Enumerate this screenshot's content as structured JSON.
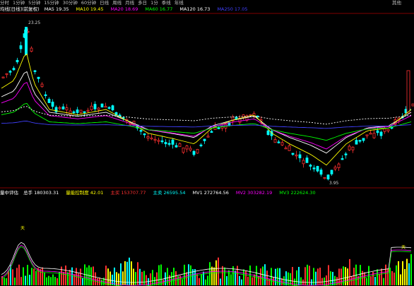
{
  "periods": [
    "分时",
    "1分钟",
    "5分钟",
    "15分钟",
    "30分钟",
    "60分钟",
    "日线",
    "周线",
    "月线",
    "多日",
    "1分",
    "季线",
    "年线"
  ],
  "toolbar_right": "其他",
  "ma_legend": {
    "title": "均线[日线](前复权)",
    "items": [
      {
        "label": "MA5",
        "value": "19.35",
        "color": "#ffffff"
      },
      {
        "label": "MA10",
        "value": "19.45",
        "color": "#ffff00"
      },
      {
        "label": "MA20",
        "value": "18.69",
        "color": "#ff00ff"
      },
      {
        "label": "MA60",
        "value": "16.77",
        "color": "#00ff00"
      },
      {
        "label": "MA120",
        "value": "16.73",
        "color": "#ffffff"
      },
      {
        "label": "MA250",
        "value": "17.05",
        "color": "#4040ff"
      }
    ]
  },
  "price_labels": {
    "high": "23.25",
    "low": "3.95"
  },
  "volume_header": {
    "title": "量中评估",
    "items": [
      {
        "label": "总手",
        "value": "180303.31",
        "color": "#ffffff"
      },
      {
        "label": "量能控制度",
        "value": "42.01",
        "color": "#ffff00"
      },
      {
        "label": "主买",
        "value": "153707.77",
        "color": "#ff3030"
      },
      {
        "label": "主卖",
        "value": "26595.54",
        "color": "#00ffff"
      },
      {
        "label": "MV1",
        "value": "272764.56",
        "color": "#ffffff"
      },
      {
        "label": "MV2",
        "value": "303282.19",
        "color": "#ff00ff"
      },
      {
        "label": "MV3",
        "value": "222624.30",
        "color": "#00ff00"
      }
    ]
  },
  "annot_char": "天",
  "colors": {
    "up": "#ff3030",
    "down": "#00ffff",
    "grid": "#800000"
  }
}
